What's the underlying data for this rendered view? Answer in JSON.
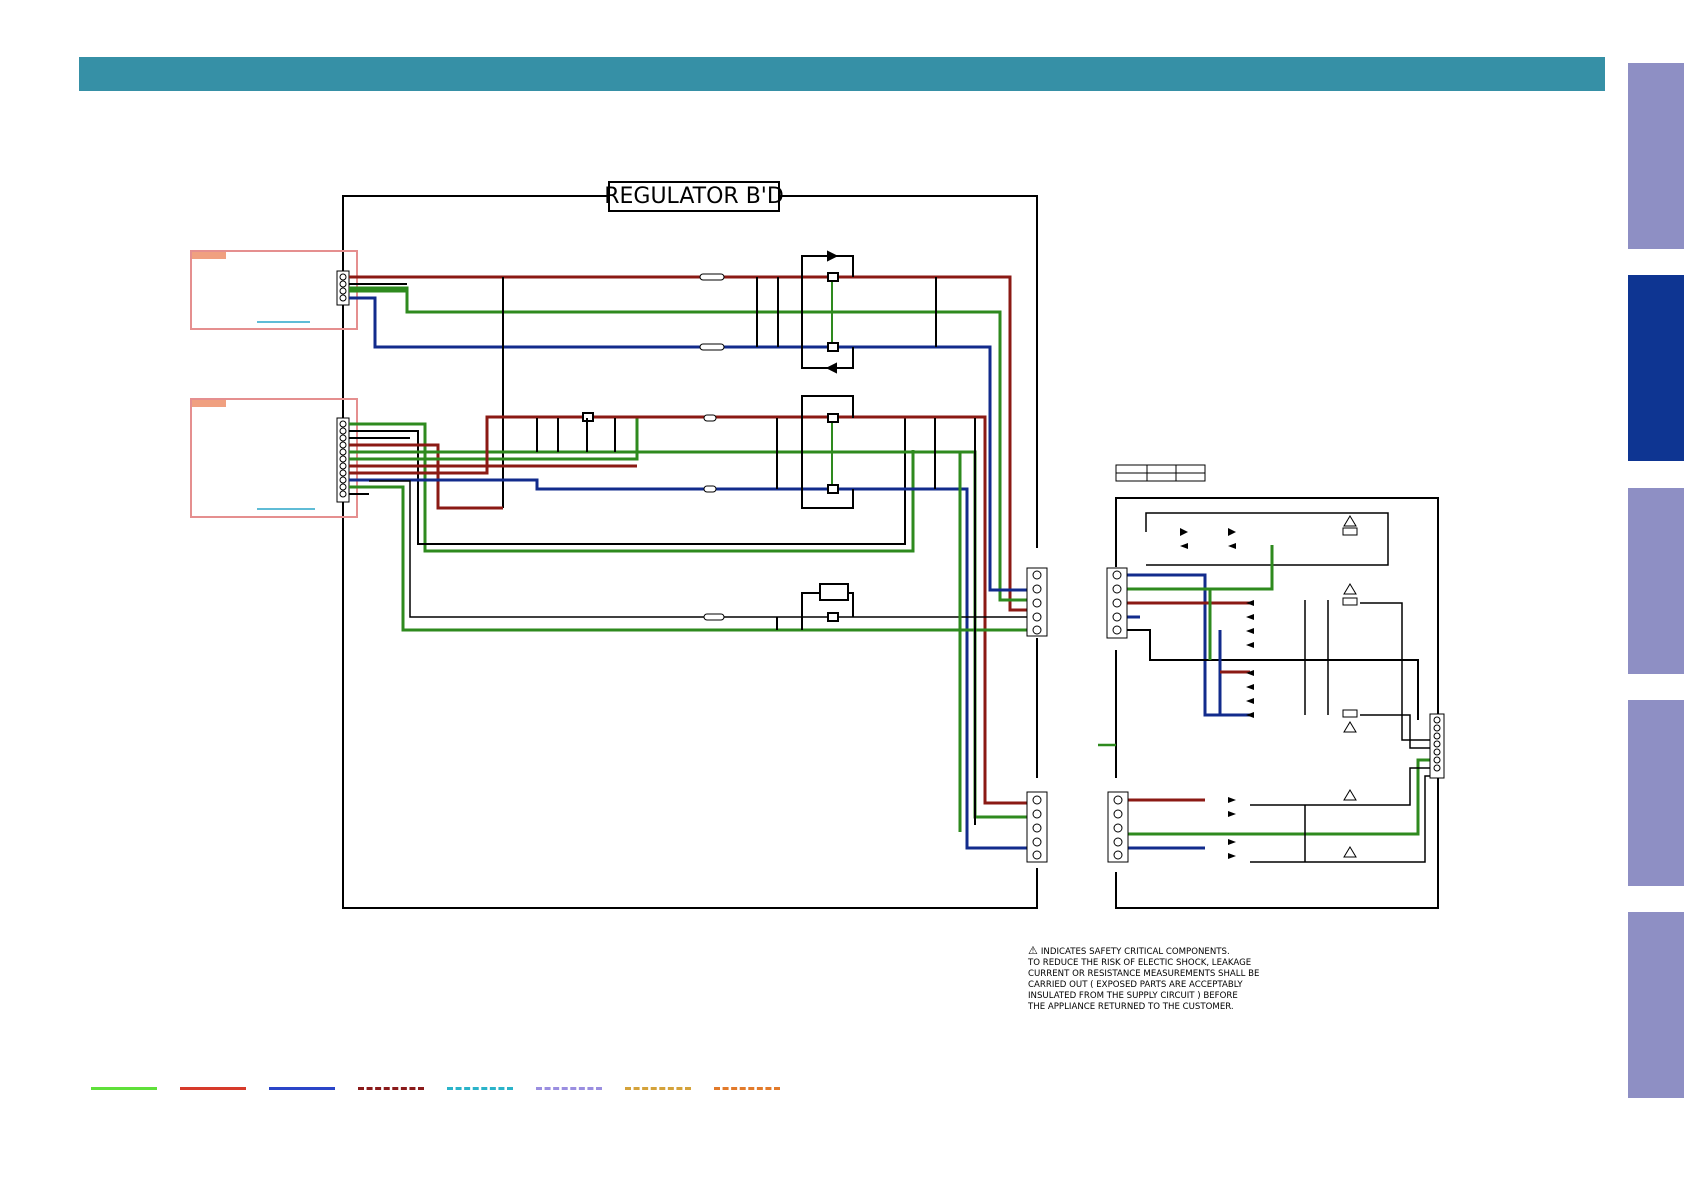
{
  "title": "REGULATOR B'D",
  "colors": {
    "header": "#3690a6",
    "tab_inactive": "#8e8fc4",
    "tab_active": "#0e3592",
    "wire_red": "#8b1a14",
    "wire_green": "#2e8a1e",
    "wire_blue": "#122b8c",
    "wire_black": "#000000",
    "connector_box": "#e58f8f",
    "connector_tag": "#f0a080"
  },
  "side_tabs": [
    {
      "state": "inactive"
    },
    {
      "state": "active"
    },
    {
      "state": "inactive"
    },
    {
      "state": "inactive"
    },
    {
      "state": "inactive"
    }
  ],
  "safety_note": {
    "icon": "warning-triangle-icon",
    "lines": [
      "INDICATES SAFETY CRITICAL COMPONENTS.",
      "TO REDUCE THE RISK OF ELECTIC SHOCK, LEAKAGE",
      "CURRENT OR RESISTANCE MEASUREMENTS SHALL BE",
      "CARRIED OUT ( EXPOSED PARTS ARE ACCEPTABLY",
      "INSULATED FROM THE SUPPLY CIRCUIT ) BEFORE",
      "THE APPLIANCE RETURNED TO THE CUSTOMER."
    ]
  },
  "legend": [
    {
      "color": "#5fe03a",
      "style": "solid"
    },
    {
      "color": "#d63a2a",
      "style": "solid"
    },
    {
      "color": "#2a45c8",
      "style": "solid"
    },
    {
      "color": "#8a1a1a",
      "style": "dashed"
    },
    {
      "color": "#2ab3c9",
      "style": "dashed"
    },
    {
      "color": "#9a8ee0",
      "style": "dashed"
    },
    {
      "color": "#d4a23a",
      "style": "dashed"
    },
    {
      "color": "#e27a2a",
      "style": "dashed"
    }
  ]
}
